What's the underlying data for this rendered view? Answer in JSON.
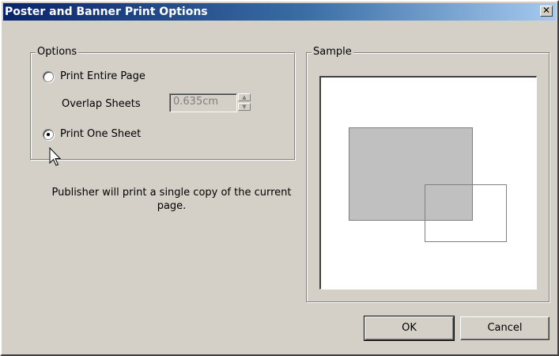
{
  "window": {
    "title": "Poster and Banner Print Options",
    "close_glyph": "✕",
    "close_icon": "close-icon"
  },
  "options": {
    "legend": "Options",
    "print_entire_page": {
      "label": "Print Entire Page",
      "checked": false
    },
    "overlap_sheets": {
      "label": "Overlap Sheets",
      "value": "0.635cm",
      "enabled": false
    },
    "print_one_sheet": {
      "label": "Print One Sheet",
      "checked": true
    }
  },
  "description": "Publisher will print a single copy of the current page.",
  "sample": {
    "legend": "Sample"
  },
  "buttons": {
    "ok": "OK",
    "cancel": "Cancel"
  },
  "colors": {
    "dialog_bg": "#d4d0c8",
    "title_start": "#0a246a",
    "title_end": "#a6caf0",
    "sample_page_fill": "#c0c0c0"
  }
}
